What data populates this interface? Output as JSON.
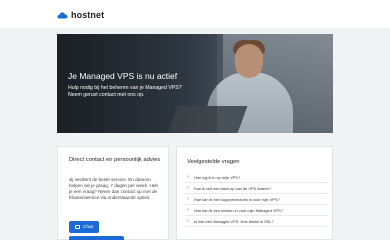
{
  "header": {
    "brand": "hostnet"
  },
  "hero": {
    "title": "Je Managed VPS is nu actief",
    "subtitle_line1": "Hulp nodig bij het beheren van je Managed VPS?",
    "subtitle_line2": "Neem gerust contact met ons op."
  },
  "contact": {
    "title": "Direct contact en persoonlijk advies",
    "text": "Jij verdient de beste service. En daarom helpen we je graag, 7 dagen per week. Heb je een vraag? Neem dan contact op met de Klantenservice via onderstaande opties.",
    "chat_label": "Chat"
  },
  "faq": {
    "title": "Veelgestelde vragen",
    "items": [
      "Hoe log ik in op mijn VPS?",
      "Kan ik zelf een back-up van de VPS maken?",
      "Hoe kan ik een supportverzoek in voor mijn VPS?",
      "Hoe kan ik een knoken in voor mijn Managed VPS?",
      "Is heb een Managed VPS: Hoe bestel ik SSL?"
    ]
  },
  "colors": {
    "brand_blue": "#1b6ad6",
    "hero_overlay": "#2a3138"
  }
}
